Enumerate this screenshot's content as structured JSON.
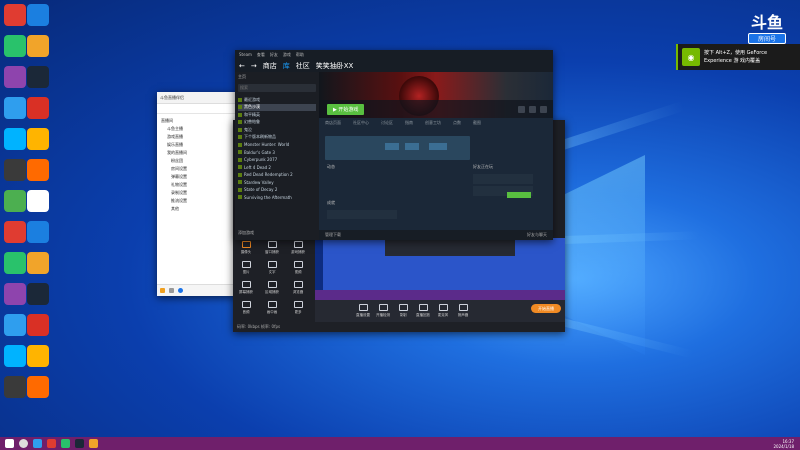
{
  "stream_overlay": {
    "logo_text": "斗鱼",
    "logo_sub": "房间号",
    "room_number": "9954659"
  },
  "nvidia_toast": {
    "line1": "按下 Alt+Z，使用 GeForce",
    "line2": "Experience 游 戏内覆盖"
  },
  "steam": {
    "menu": [
      "Steam",
      "查看",
      "好友",
      "游戏",
      "帮助"
    ],
    "nav": {
      "back": "←",
      "forward": "→",
      "store": "商店",
      "library": "库",
      "community": "社区",
      "user": "笑笑抽卧XX"
    },
    "sidebar_header": "主页",
    "search_placeholder": "搜索",
    "games": [
      {
        "name": "最近游戏",
        "highlight": false
      },
      {
        "name": "黑色沙漠",
        "highlight": true
      },
      {
        "name": "和平精英",
        "highlight": false
      },
      {
        "name": "幻兽帕鲁",
        "highlight": false
      },
      {
        "name": "鬼泣",
        "highlight": false
      },
      {
        "name": "下个版本刷新物品",
        "highlight": false
      },
      {
        "name": "Monster Hunter: World",
        "highlight": false
      },
      {
        "name": "Baldur's Gate 3",
        "highlight": false
      },
      {
        "name": "Cyberpunk 2077",
        "highlight": false
      },
      {
        "name": "Left 4 Dead 2",
        "highlight": false
      },
      {
        "name": "Red Dead Redemption 2",
        "highlight": false
      },
      {
        "name": "Stardew Valley",
        "highlight": false
      },
      {
        "name": "State of Decay 2",
        "highlight": false
      },
      {
        "name": "Surviving the Aftermath",
        "highlight": false
      }
    ],
    "add_game": "添加游戏",
    "play_button": "▶ 开始游戏",
    "tabs": [
      "商店页面",
      "社区中心",
      "讨论区",
      "指南",
      "创意工坊",
      "点数",
      "截图"
    ],
    "activity_label": "动态",
    "friends_label": "好友",
    "achievements_label": "成就",
    "news_label": "好友正在玩",
    "downloads": "管理下载",
    "friends_chat": "好友与聊天"
  },
  "qq": {
    "title": "斗鱼直播伴侣",
    "tree": [
      "直播间",
      "斗鱼主播",
      "游戏直播",
      "娱乐直播",
      "我的直播间",
      "粉丝团",
      "房间设置",
      "弹幕设置",
      "礼物设置",
      "录制设置",
      "推流设置",
      "其他"
    ]
  },
  "broadcaster": {
    "tools_row1": [
      "摄像头",
      "窗口捕获",
      "游戏捕获"
    ],
    "tools_row2": [
      "图片",
      "文字",
      "视频"
    ],
    "tools_row3": [
      "屏幕捕获",
      "区域捕获",
      "浏览器"
    ],
    "tools_row4": [
      "音频",
      "画中画",
      "更多"
    ],
    "bottom_tools": [
      "直播设置",
      "开播检测",
      "录制",
      "直播回放",
      "麦克风",
      "扬声器"
    ],
    "go_live": "开始直播",
    "status_text": "码率: 0kbps  帧率: 0fps"
  },
  "taskbar": {
    "time": "16:37",
    "date": "2024/1/18"
  },
  "desktop_icon_colors": [
    "#e03c31",
    "#1b7fe0",
    "#29c26b",
    "#f1a42a",
    "#8e44ad",
    "#1b2838",
    "#2f9eee",
    "#d93025",
    "#00b3ff",
    "#ffb400",
    "#3a3a3a",
    "#ff6a00",
    "#4caf50",
    "#ffffff"
  ]
}
